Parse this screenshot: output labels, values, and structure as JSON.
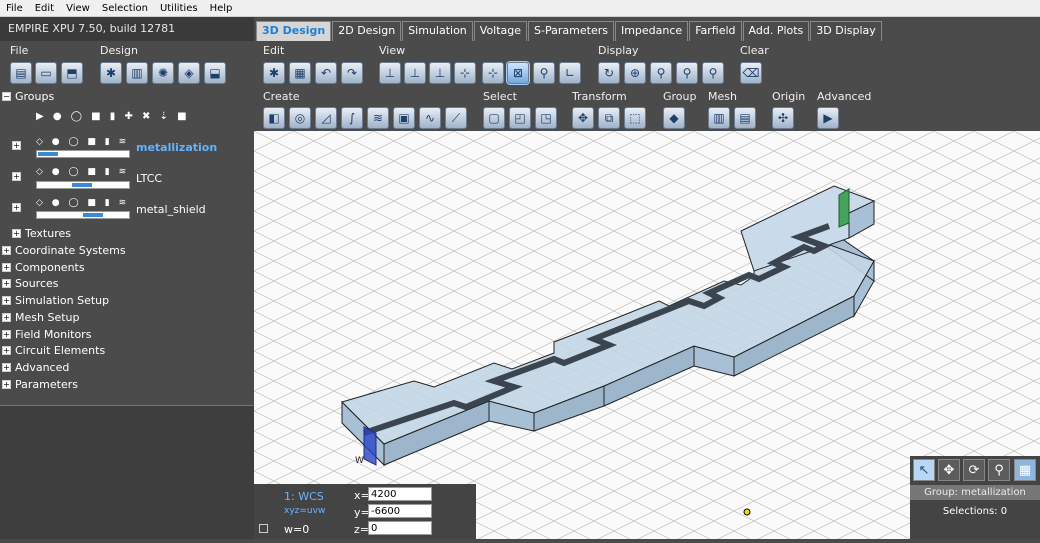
{
  "menu": [
    "File",
    "Edit",
    "View",
    "Selection",
    "Utilities",
    "Help"
  ],
  "app_title": "EMPIRE XPU 7.50, build 12781",
  "tabs": [
    "3D Design",
    "2D Design",
    "Simulation",
    "Voltage",
    "S-Parameters",
    "Impedance",
    "Farfield",
    "Add. Plots",
    "3D Display"
  ],
  "active_tab": "3D Design",
  "ribbon": {
    "left_groups": {
      "file": "File",
      "design": "Design"
    },
    "row1_groups": {
      "edit": "Edit",
      "view": "View",
      "display": "Display",
      "clear": "Clear"
    },
    "row2_groups": {
      "create": "Create",
      "select": "Select",
      "transform": "Transform",
      "group": "Group",
      "mesh": "Mesh",
      "origin": "Origin",
      "advanced": "Advanced"
    }
  },
  "tree": {
    "groups_label": "Groups",
    "groups": [
      {
        "name": "metallization",
        "selected": true,
        "opacity": 0.23
      },
      {
        "name": "LTCC",
        "selected": false,
        "opacity": 0.6
      },
      {
        "name": "metal_shield",
        "selected": false,
        "opacity": 0.72
      }
    ],
    "textures_label": "Textures",
    "sections": [
      "Coordinate Systems",
      "Components",
      "Sources",
      "Simulation Setup",
      "Mesh Setup",
      "Field Monitors",
      "Circuit Elements",
      "Advanced",
      "Parameters"
    ]
  },
  "coords": {
    "wcs_label": "1: WCS",
    "xyz_label": "xyz=uvw",
    "x_label": "x=",
    "x": "4200",
    "y_label": "y=",
    "y": "-6600",
    "w_label": "w=0",
    "z_label": "z=",
    "z": "0"
  },
  "status": {
    "group": "Group: metallization",
    "selections": "Selections: 0"
  },
  "nav_icons": [
    "select-arrow-icon",
    "pan-icon",
    "rotate-icon",
    "zoom-icon",
    "grid-icon"
  ],
  "colors": {
    "accent": "#1f7fd1",
    "selected_group": "#62b2ff",
    "model_fill": "#b8cfe0",
    "trace": "#3a4550"
  }
}
